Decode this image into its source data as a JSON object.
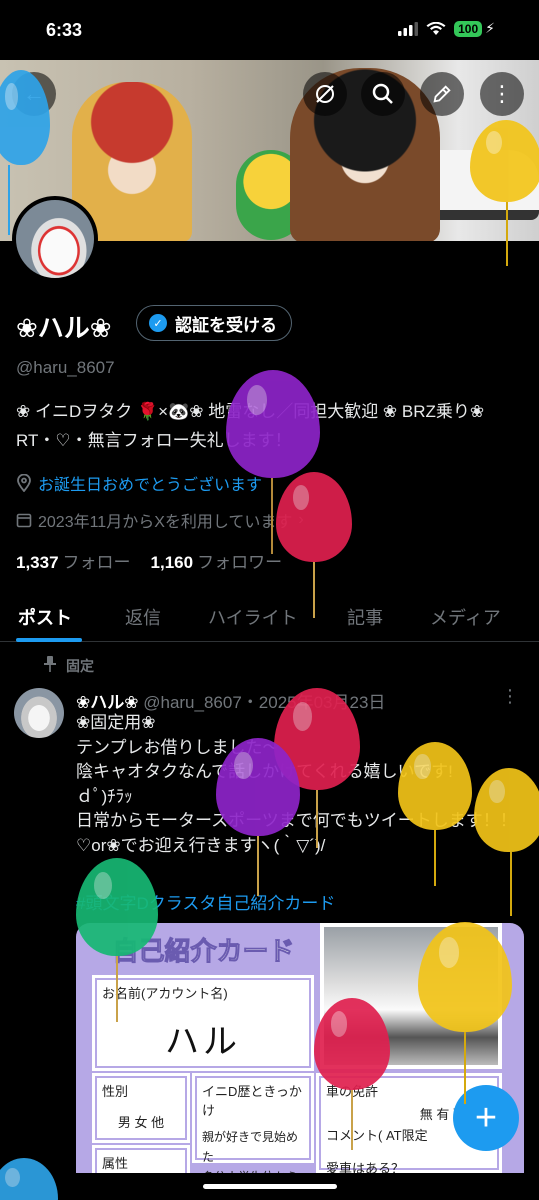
{
  "status": {
    "time": "6:33",
    "battery": "100"
  },
  "header": {
    "buttons": [
      {
        "name": "hide-icon-button",
        "icon": "eye-off-icon"
      },
      {
        "name": "search-button",
        "icon": "search-icon"
      },
      {
        "name": "edit-button",
        "icon": "pencil-icon"
      },
      {
        "name": "more-button",
        "icon": "more-vertical-icon"
      }
    ]
  },
  "profile": {
    "display_name": "❀ハル❀",
    "verify_label": "認証を受ける",
    "handle": "@haru_8607",
    "bio": "❀ イニDヲタク 🌹×🐼❀ 地雷なし／同担大歓迎 ❀ BRZ乗り❀ RT・♡・無言フォロー失礼します！",
    "birthday": "お誕生日おめでとうございます",
    "joined": "2023年11月からXを利用しています",
    "following_count": "1,337",
    "following_label": "フォロー",
    "followers_count": "1,160",
    "followers_label": "フォロワー"
  },
  "tabs": [
    "ポスト",
    "返信",
    "ハイライト",
    "記事",
    "メディア"
  ],
  "pinned_post": {
    "pinned_label": "固定",
    "author": "❀ハル❀",
    "handle_date": "@haru_8607・2025年03月23日",
    "text": "❀固定用❀\nテンプレお借りしました〜\n陰キャオタクなんで話しかけてくれる嬉しいです!\nｄﾟ)ﾁﾗｯ\n日常からモータースポーツまで何でもツイートします！！\n♡or❀でお迎え行きますヽ(｀▽´)/",
    "hashtag": "#頭文字Dクラスタ自己紹介カード",
    "card": {
      "title": "自己紹介カード",
      "name_label": "お名前(アカウント名)",
      "name_value": "ハル",
      "gender_label": "性別",
      "gender_options": "男 女 他",
      "reason_label": "イニD歴ときっかけ",
      "reason_text": "親が好きで見始めた\n多分小学生位から",
      "license_label": "車の免許",
      "license_value": "無 有 取得中",
      "license_comment": "コメント( AT限定",
      "car_label": "愛車はある？",
      "attr_label": "属性"
    }
  },
  "fab_label": "+"
}
